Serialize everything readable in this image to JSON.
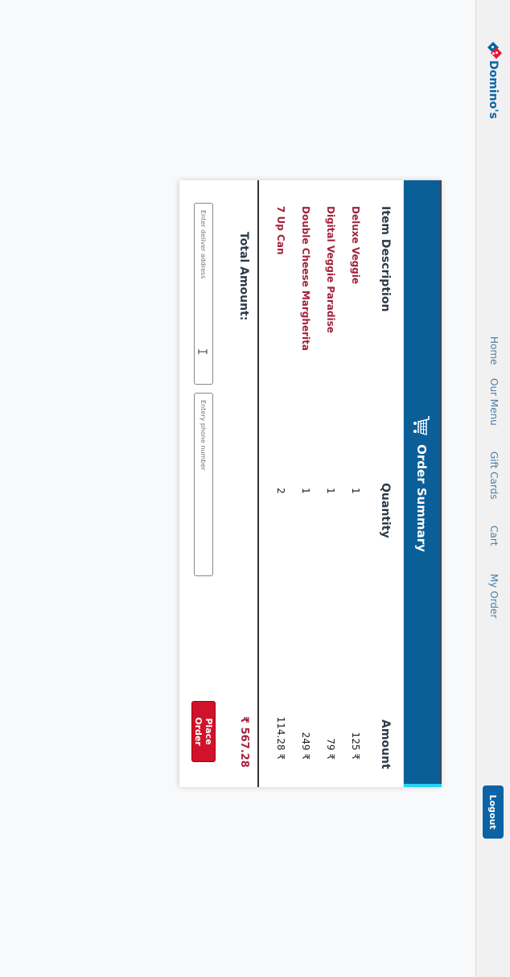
{
  "navbar": {
    "brand": "Domino's",
    "links": [
      "Home",
      "Our Menu",
      "Gift Cards",
      "Cart",
      "My Order"
    ],
    "logout_label": "Logout"
  },
  "order": {
    "title": "Order Summary",
    "columns": {
      "item": "Item Description",
      "qty": "Quantity",
      "amount": "Amount"
    },
    "items": [
      {
        "name": "Deluxe Veggie",
        "qty": "1",
        "amount": "₹ 125"
      },
      {
        "name": "Digital Veggie Paradise",
        "qty": "1",
        "amount": "₹ 79"
      },
      {
        "name": "Double Cheese Margherita",
        "qty": "1",
        "amount": "₹ 249"
      },
      {
        "name": "7 Up Can",
        "qty": "2",
        "amount": "₹ 114.28"
      }
    ],
    "total_label": "Total Amount:",
    "total_value": "₹ 567.28"
  },
  "form": {
    "address_placeholder": "Enter deliver address",
    "phone_placeholder": "Entery phone number",
    "place_order_label": "Place Order"
  },
  "colors": {
    "brand_blue": "#0b63a5",
    "header_blue": "#0b5f99",
    "accent_red": "#d0122b",
    "item_text": "#a2233c"
  }
}
